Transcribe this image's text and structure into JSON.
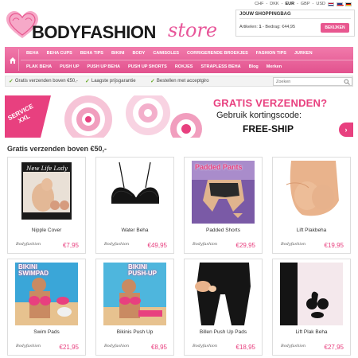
{
  "header": {
    "logo_main": "BODYFASHION",
    "logo_store": "store",
    "currencies": [
      "CHF",
      "DKK",
      "EUR",
      "GBP",
      "USD"
    ],
    "currency_selected": "EUR",
    "cart": {
      "title": "JOUW SHOPPINGBAG",
      "info_label": "Artikelen:",
      "info_count": "1",
      "info_amount_label": "- Bedrag:",
      "info_amount": "€44,95",
      "button_label": "BEKIJKEN"
    }
  },
  "nav": {
    "row1": [
      "BEHA",
      "BEHA CUPS",
      "BEHA TIPS",
      "BIKINI",
      "BODY",
      "CAMISOLES",
      "CORRIGERENDE BROEKJES",
      "FASHION TIPS",
      "JURKEN"
    ],
    "row2": [
      "PLAK BEHA",
      "PUSH UP",
      "PUSH UP BEHA",
      "PUSH UP SHORTS",
      "ROKJES",
      "STRAPLESS BEHA",
      "Blog",
      "Merken"
    ]
  },
  "usp": {
    "items": [
      "Gratis verzenden boven €50,-",
      "Laagste prijsgarantie",
      "Bestellen met acceptgiro"
    ],
    "search_placeholder": "Zoeken"
  },
  "banner": {
    "badge": "SERVICE XXL",
    "line1": "GRATIS VERZENDEN?",
    "line2": "Gebruik kortingscode:",
    "line3": "FREE-SHIP"
  },
  "section_title": "Gratis verzenden boven €50,-",
  "products": [
    {
      "name": "Nipple Cover",
      "price": "€7,95",
      "brand": "Bodyfashion",
      "img_text": "New Life Lady"
    },
    {
      "name": "Water Beha",
      "price": "€49,95",
      "brand": "Bodyfashion",
      "img_text": ""
    },
    {
      "name": "Padded Shorts",
      "price": "€29,95",
      "brand": "Bodyfashion",
      "img_text": "Padded Pants"
    },
    {
      "name": "Lift Plakbeha",
      "price": "€19,95",
      "brand": "Bodyfashion",
      "img_text": ""
    },
    {
      "name": "Swim Pads",
      "price": "€21,95",
      "brand": "Bodyfashion",
      "img_text": "BIKINI SWIMPAD"
    },
    {
      "name": "Bikinis Push Up",
      "price": "€8,95",
      "brand": "Bodyfashion",
      "img_text": "BIKINI PUSH-UP"
    },
    {
      "name": "Billen Push Up Pads",
      "price": "€18,95",
      "brand": "Bodyfashion",
      "img_text": ""
    },
    {
      "name": "Lift Plak Beha",
      "price": "€27,95",
      "brand": "Bodyfashion",
      "img_text": ""
    }
  ],
  "colors": {
    "brand_pink": "#e8578f",
    "nav_pink": "#f17aab",
    "price_pink": "#e8407f",
    "check_green": "#6aaa2a"
  }
}
